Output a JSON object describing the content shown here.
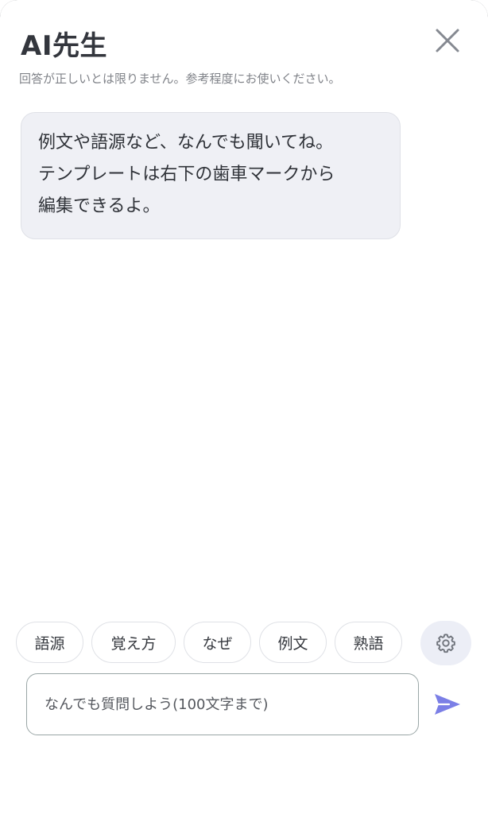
{
  "header": {
    "title": "AI先生",
    "close_icon": "close-icon",
    "disclaimer": "回答が正しいとは限りません。参考程度にお使いください。"
  },
  "messages": [
    {
      "role": "assistant",
      "lines": [
        "例文や語源など、なんでも聞いてね。",
        "テンプレートは右下の歯車マークから",
        "編集できるよ。"
      ]
    }
  ],
  "quick_prompts": [
    {
      "label": "語源"
    },
    {
      "label": "覚え方"
    },
    {
      "label": "なぜ"
    },
    {
      "label": "例文"
    },
    {
      "label": "熟語"
    }
  ],
  "settings": {
    "icon": "gear-icon"
  },
  "composer": {
    "placeholder": "なんでも質問しよう(100文字まで)",
    "value": "",
    "send_icon": "send-icon"
  },
  "colors": {
    "accent": "#7b7fe6",
    "bubble_bg": "#eff0f5",
    "title": "#33363d",
    "muted": "#808389"
  }
}
